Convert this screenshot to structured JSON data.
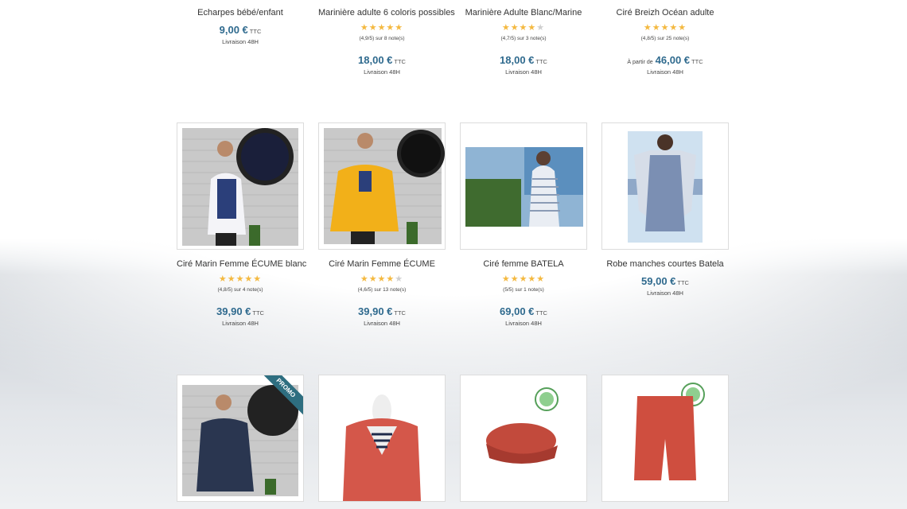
{
  "products": [
    {
      "name": "Echarpes bébé/enfant",
      "rating": null,
      "price": "9,00 €",
      "ttc": "TTC",
      "shipping": "Livraison 48H"
    },
    {
      "name": "Marinière adulte 6 coloris possibles",
      "rating": "(4,9/5) sur 8 note(s)",
      "stars": 5,
      "price": "18,00 €",
      "ttc": "TTC",
      "shipping": "Livraison 48H"
    },
    {
      "name": "Marinière Adulte Blanc/Marine",
      "rating": "(4,7/5) sur 3 note(s)",
      "stars": 4.5,
      "price": "18,00 €",
      "ttc": "TTC",
      "shipping": "Livraison 48H"
    },
    {
      "name": "Ciré Breizh Océan adulte",
      "rating": "(4,8/5) sur 25 note(s)",
      "stars": 5,
      "price_prefix": "À partir de",
      "price": "46,00 €",
      "ttc": "TTC",
      "shipping": "Livraison 48H"
    },
    {
      "name": "Ciré Marin Femme ÉCUME blanc",
      "rating": "(4,8/5) sur 4 note(s)",
      "stars": 5,
      "price": "39,90 €",
      "ttc": "TTC",
      "shipping": "Livraison 48H"
    },
    {
      "name": "Ciré Marin Femme ÉCUME",
      "rating": "(4,6/5) sur 13 note(s)",
      "stars": 4.5,
      "price": "39,90 €",
      "ttc": "TTC",
      "shipping": "Livraison 48H"
    },
    {
      "name": "Ciré femme BATELA",
      "rating": "(5/5) sur 1 note(s)",
      "stars": 5,
      "price": "69,00 €",
      "ttc": "TTC",
      "shipping": "Livraison 48H"
    },
    {
      "name": "Robe manches courtes Batela",
      "rating": null,
      "price": "59,00 €",
      "ttc": "TTC",
      "shipping": "Livraison 48H"
    }
  ],
  "promo_label": "PROMO",
  "colors": {
    "price": "#2f6a8e",
    "star": "#f4b940",
    "ribbon": "#2e6e80"
  }
}
